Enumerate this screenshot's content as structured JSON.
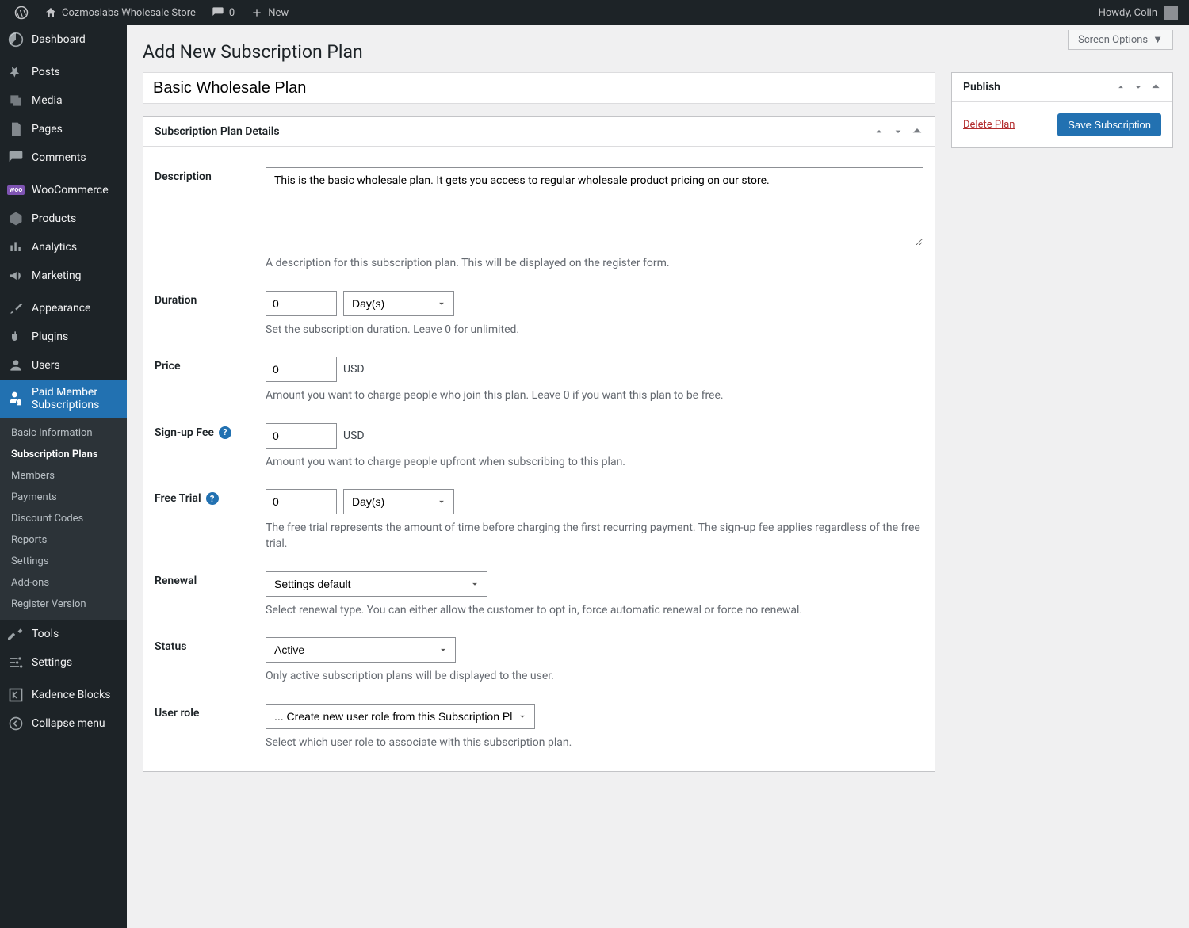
{
  "adminbar": {
    "site_name": "Cozmoslabs Wholesale Store",
    "comments_count": "0",
    "new_label": "New",
    "howdy": "Howdy, Colin"
  },
  "screen_options_label": "Screen Options",
  "page_title": "Add New Subscription Plan",
  "title_value": "Basic Wholesale Plan",
  "sidebar": {
    "dashboard": "Dashboard",
    "posts": "Posts",
    "media": "Media",
    "pages": "Pages",
    "comments": "Comments",
    "woocommerce": "WooCommerce",
    "products": "Products",
    "analytics": "Analytics",
    "marketing": "Marketing",
    "appearance": "Appearance",
    "plugins": "Plugins",
    "users": "Users",
    "pms": "Paid Member Subscriptions",
    "tools": "Tools",
    "settings": "Settings",
    "kadence": "Kadence Blocks",
    "collapse": "Collapse menu"
  },
  "submenu": {
    "basic_info": "Basic Information",
    "subscription_plans": "Subscription Plans",
    "members": "Members",
    "payments": "Payments",
    "discount_codes": "Discount Codes",
    "reports": "Reports",
    "settings": "Settings",
    "addons": "Add-ons",
    "register_version": "Register Version"
  },
  "details": {
    "box_title": "Subscription Plan Details",
    "description_label": "Description",
    "description_value": "This is the basic wholesale plan. It gets you access to regular wholesale product pricing on our store.",
    "description_hint": "A description for this subscription plan. This will be displayed on the register form.",
    "duration_label": "Duration",
    "duration_value": "0",
    "duration_unit": "Day(s)",
    "duration_hint": "Set the subscription duration. Leave 0 for unlimited.",
    "price_label": "Price",
    "price_value": "0",
    "price_currency": "USD",
    "price_hint": "Amount you want to charge people who join this plan. Leave 0 if you want this plan to be free.",
    "signup_label": "Sign-up Fee",
    "signup_value": "0",
    "signup_currency": "USD",
    "signup_hint": "Amount you want to charge people upfront when subscribing to this plan.",
    "trial_label": "Free Trial",
    "trial_value": "0",
    "trial_unit": "Day(s)",
    "trial_hint": "The free trial represents the amount of time before charging the first recurring payment. The sign-up fee applies regardless of the free trial.",
    "renewal_label": "Renewal",
    "renewal_value": "Settings default",
    "renewal_hint": "Select renewal type. You can either allow the customer to opt in, force automatic renewal or force no renewal.",
    "status_label": "Status",
    "status_value": "Active",
    "status_hint": "Only active subscription plans will be displayed to the user.",
    "role_label": "User role",
    "role_value": "... Create new user role from this Subscription Plan",
    "role_hint": "Select which user role to associate with this subscription plan."
  },
  "publish": {
    "box_title": "Publish",
    "delete_label": "Delete Plan",
    "save_label": "Save Subscription"
  }
}
